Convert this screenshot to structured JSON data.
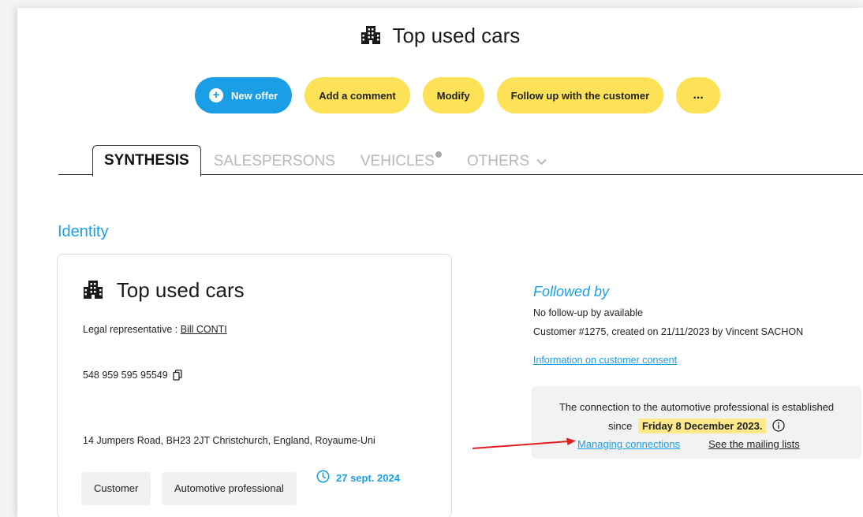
{
  "header": {
    "title": "Top used cars",
    "icon": "building-icon"
  },
  "actions": {
    "new_offer": "New offer",
    "add_comment": "Add a comment",
    "modify": "Modify",
    "follow_up": "Follow up with the customer",
    "more": "..."
  },
  "tabs": [
    {
      "label": "SYNTHESIS",
      "active": true
    },
    {
      "label": "SALESPERSONS",
      "active": false
    },
    {
      "label": "VEHICLES",
      "active": false
    },
    {
      "label": "OTHERS",
      "active": false
    }
  ],
  "identity": {
    "section_title": "Identity",
    "name": "Top used cars",
    "legal_rep_label": "Legal representative : ",
    "legal_rep_name": "Bill CONTI",
    "registration": "548 959 595 95549",
    "address": "14 Jumpers Road, BH23 2JT Christchurch, England, Royaume-Uni",
    "badges": [
      "Customer",
      "Automotive professional"
    ],
    "date": "27 sept. 2024"
  },
  "followed_by": {
    "title": "Followed by",
    "no_follow_up": "No follow-up by available",
    "customer_info": "Customer #1275, created on 21/11/2023 by Vincent SACHON",
    "consent_link": "Information on customer consent",
    "connection_text": "The connection to the automotive professional is established",
    "since_label": "since",
    "since_date": "Friday 8 December 2023.",
    "managing_link": "Managing connections",
    "mailing_link": "See the mailing lists"
  },
  "colors": {
    "accent_blue": "#1a9ee6",
    "button_yellow": "#fde157",
    "highlight_yellow": "#fde98a",
    "annotation_arrow": "#e02020"
  }
}
